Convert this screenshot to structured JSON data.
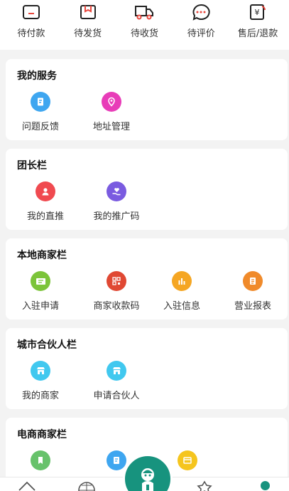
{
  "orders": [
    {
      "label": "待付款",
      "icon": "wallet-icon"
    },
    {
      "label": "待发货",
      "icon": "package-icon"
    },
    {
      "label": "待收货",
      "icon": "truck-icon"
    },
    {
      "label": "待评价",
      "icon": "comment-icon"
    },
    {
      "label": "售后/退款",
      "icon": "refund-icon"
    }
  ],
  "sections": [
    {
      "title": "我的服务",
      "items": [
        {
          "label": "问题反馈",
          "icon": "feedback-icon",
          "color": "#3ea6f0"
        },
        {
          "label": "地址管理",
          "icon": "location-icon",
          "color": "#e83cb8"
        }
      ]
    },
    {
      "title": "团长栏",
      "items": [
        {
          "label": "我的直推",
          "icon": "person-icon",
          "color": "#f04a50"
        },
        {
          "label": "我的推广码",
          "icon": "heart-hand-icon",
          "color": "#7a5be0"
        }
      ]
    },
    {
      "title": "本地商家栏",
      "items": [
        {
          "label": "入驻申请",
          "icon": "id-card-icon",
          "color": "#7cc43a"
        },
        {
          "label": "商家收款码",
          "icon": "qrcode-icon",
          "color": "#e04833"
        },
        {
          "label": "入驻信息",
          "icon": "bar-chart-icon",
          "color": "#f5a623"
        },
        {
          "label": "营业报表",
          "icon": "report-icon",
          "color": "#f08a2a"
        }
      ]
    },
    {
      "title": "城市合伙人栏",
      "items": [
        {
          "label": "我的商家",
          "icon": "shop-icon",
          "color": "#41c8ef"
        },
        {
          "label": "申请合伙人",
          "icon": "shop-icon",
          "color": "#41c8ef"
        }
      ]
    },
    {
      "title": "电商商家栏",
      "items": [
        {
          "label": "",
          "icon": "bookmark-icon",
          "color": "#67c26b"
        },
        {
          "label": "",
          "icon": "document-icon",
          "color": "#3ea6f0"
        },
        {
          "label": "",
          "icon": "store-icon",
          "color": "#f5c51e"
        }
      ]
    }
  ],
  "tabbar": {
    "accent": "#17937e",
    "tabs": [
      {
        "icon": "home-icon"
      },
      {
        "icon": "globe-icon"
      },
      {
        "icon": "center-mascot-icon"
      },
      {
        "icon": "star-badge-icon"
      },
      {
        "icon": "profile-active-icon"
      }
    ]
  }
}
